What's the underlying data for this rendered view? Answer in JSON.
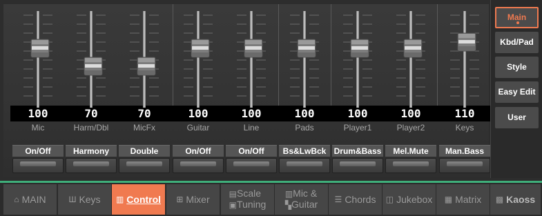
{
  "channels": [
    {
      "name": "Mic",
      "value": "100",
      "level": 100,
      "button": "On/Off"
    },
    {
      "name": "Harm/Dbl",
      "value": "70",
      "level": 70,
      "button": "Harmony"
    },
    {
      "name": "MicFx",
      "value": "70",
      "level": 70,
      "button": "Double"
    },
    {
      "name": "Guitar",
      "value": "100",
      "level": 100,
      "button": "On/Off"
    },
    {
      "name": "Line",
      "value": "100",
      "level": 100,
      "button": "On/Off"
    },
    {
      "name": "Pads",
      "value": "100",
      "level": 100,
      "button": "Bs&LwBck"
    },
    {
      "name": "Player1",
      "value": "100",
      "level": 100,
      "button": "Drum&Bass"
    },
    {
      "name": "Player2",
      "value": "100",
      "level": 100,
      "button": "Mel.Mute"
    },
    {
      "name": "Keys",
      "value": "110",
      "level": 110,
      "button": "Man.Bass"
    }
  ],
  "side_tabs": [
    "Main",
    "Kbd/Pad",
    "Style",
    "Easy Edit",
    "User"
  ],
  "side_active": "Main",
  "nav": {
    "main": "MAIN",
    "keys": "Keys",
    "control": "Control",
    "mixer": "Mixer",
    "scale_1": "Scale",
    "scale_2": "Tuning",
    "mic_1": "Mic &",
    "mic_2": "Guitar",
    "chords": "Chords",
    "jukebox": "Jukebox",
    "matrix": "Matrix",
    "kaoss": "Kaoss"
  },
  "nav_active": "Control",
  "colors": {
    "accent": "#f07a50",
    "separator_line": "#3fae7a"
  }
}
